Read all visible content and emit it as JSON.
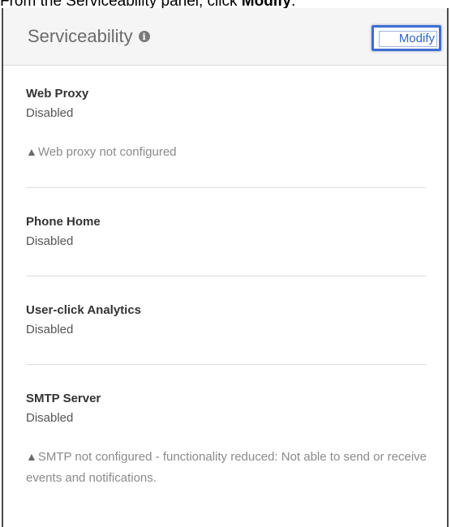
{
  "caption": {
    "prefix": "From the Serviceability panel, click ",
    "bold": "Modify",
    "suffix": "."
  },
  "panel": {
    "title": "Serviceability",
    "modify_label": "Modify"
  },
  "sections": [
    {
      "title": "Web Proxy",
      "value": "Disabled",
      "warning": "Web proxy not configured"
    },
    {
      "title": "Phone Home",
      "value": "Disabled"
    },
    {
      "title": "User-click Analytics",
      "value": "Disabled"
    },
    {
      "title": "SMTP Server",
      "value": "Disabled",
      "warning": "SMTP not configured - functionality reduced: Not able to send or receive events and notifications."
    }
  ],
  "colors": {
    "accent": "#3f6ed0",
    "link": "#2f67c8"
  }
}
